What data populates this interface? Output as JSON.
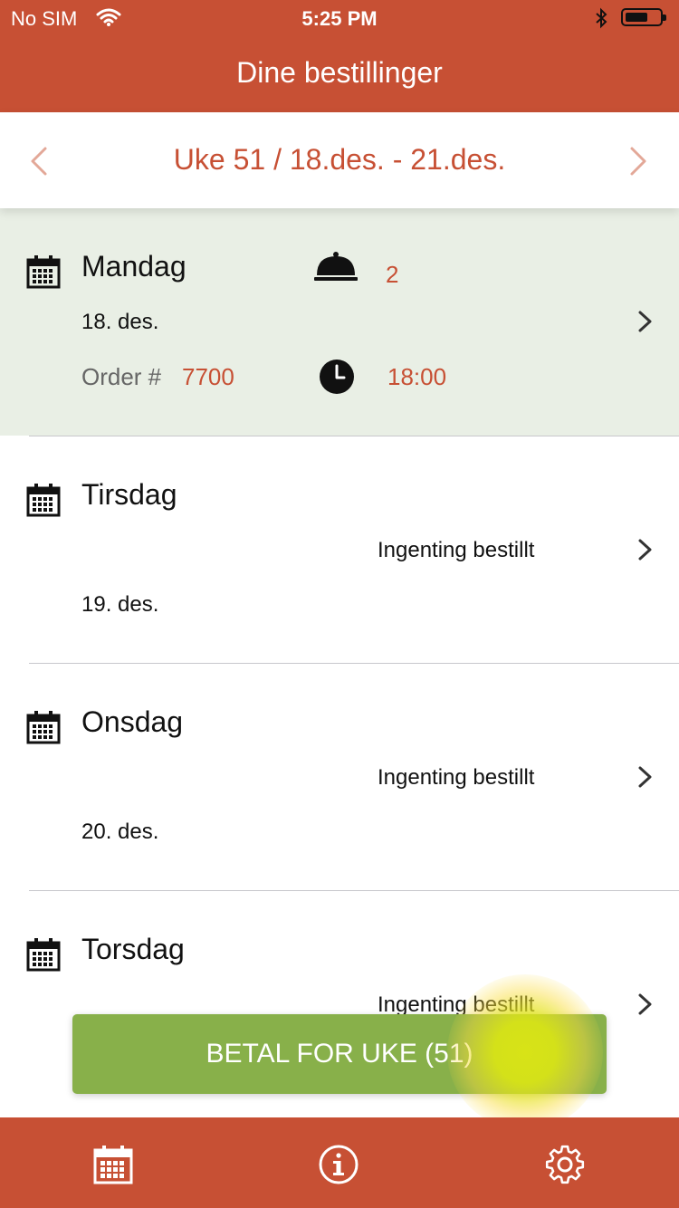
{
  "status_bar": {
    "carrier": "No SIM",
    "time": "5:25 PM"
  },
  "header": {
    "title": "Dine bestillinger"
  },
  "week": {
    "label": "Uke 51 / 18.des. - 21.des."
  },
  "days": [
    {
      "name": "Mandag",
      "date": "18. des.",
      "order_label": "Order #",
      "order_number": "7700",
      "quantity": "2",
      "time": "18:00"
    },
    {
      "name": "Tirsdag",
      "date": "19. des.",
      "status": "Ingenting bestillt"
    },
    {
      "name": "Onsdag",
      "date": "20. des.",
      "status": "Ingenting bestillt"
    },
    {
      "name": "Torsdag",
      "status": "Ingenting bestillt"
    }
  ],
  "pay_button": {
    "label": "BETAL FOR UKE (51)"
  },
  "colors": {
    "brand": "#c75034",
    "selected_row": "#e9efe5",
    "pay_button": "#88b04a"
  },
  "tabbar": {
    "icons": [
      "calendar-icon",
      "info-icon",
      "gear-icon"
    ]
  }
}
